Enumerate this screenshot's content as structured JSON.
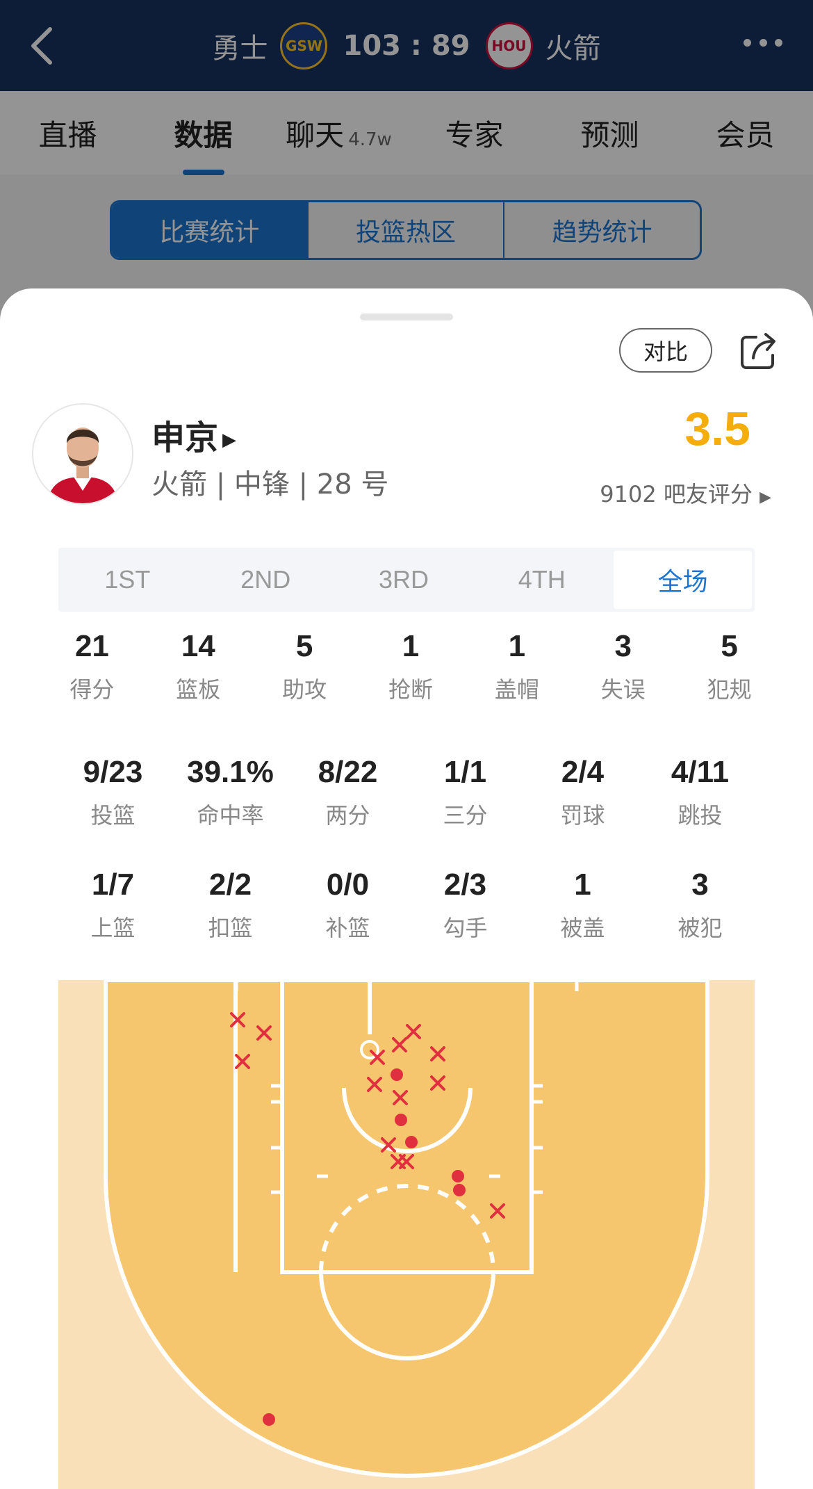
{
  "header": {
    "home_team": "勇士",
    "home_logo": "GSW",
    "score": "103 : 89",
    "away_logo": "HOU",
    "away_team": "火箭"
  },
  "tabs": [
    {
      "label": "直播"
    },
    {
      "label": "数据"
    },
    {
      "label": "聊天",
      "count": "4.7w"
    },
    {
      "label": "专家"
    },
    {
      "label": "预测"
    },
    {
      "label": "会员"
    }
  ],
  "subtabs": [
    "比赛统计",
    "投篮热区",
    "趋势统计"
  ],
  "sheet": {
    "compare_label": "对比",
    "player": {
      "name": "申京",
      "info": "火箭 | 中锋 | 28 号",
      "rating": "3.5",
      "rating_votes": "9102 吧友评分"
    },
    "periods": [
      "1ST",
      "2ND",
      "3RD",
      "4TH",
      "全场"
    ],
    "active_period": "全场",
    "stats_row1": [
      {
        "value": "21",
        "label": "得分"
      },
      {
        "value": "14",
        "label": "篮板"
      },
      {
        "value": "5",
        "label": "助攻"
      },
      {
        "value": "1",
        "label": "抢断"
      },
      {
        "value": "1",
        "label": "盖帽"
      },
      {
        "value": "3",
        "label": "失误"
      },
      {
        "value": "5",
        "label": "犯规"
      }
    ],
    "stats_row2": [
      {
        "value": "9/23",
        "label": "投篮"
      },
      {
        "value": "39.1%",
        "label": "命中率"
      },
      {
        "value": "8/22",
        "label": "两分"
      },
      {
        "value": "1/1",
        "label": "三分"
      },
      {
        "value": "2/4",
        "label": "罚球"
      },
      {
        "value": "4/11",
        "label": "跳投"
      }
    ],
    "stats_row3": [
      {
        "value": "1/7",
        "label": "上篮"
      },
      {
        "value": "2/2",
        "label": "扣篮"
      },
      {
        "value": "0/0",
        "label": "补篮"
      },
      {
        "value": "2/3",
        "label": "勾手"
      },
      {
        "value": "1",
        "label": "被盖"
      },
      {
        "value": "3",
        "label": "被犯"
      }
    ]
  },
  "colors": {
    "accent": "#1d75d0",
    "rating": "#f4ad0a",
    "made_shot": "#e0303f",
    "court_paint": "#f6c66e",
    "court_outer": "#f9e0b8"
  },
  "icons": {
    "back": "chevron-left-icon",
    "more": "more-dots-icon",
    "share": "share-icon",
    "made": "made-shot-dot-icon",
    "missed": "missed-shot-x-icon"
  }
}
